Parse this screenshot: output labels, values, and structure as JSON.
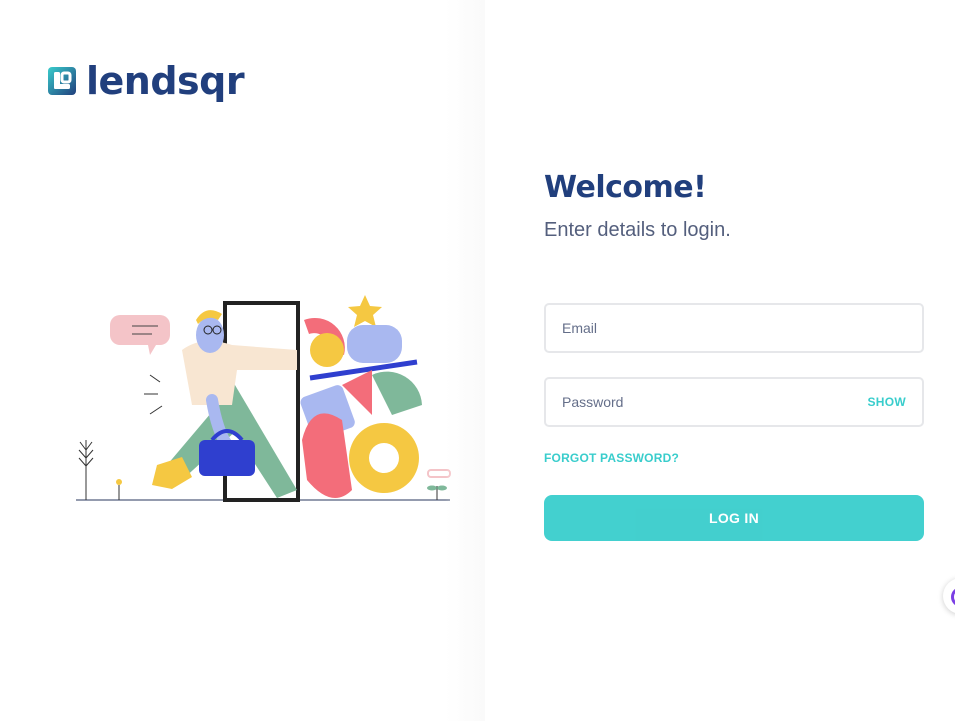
{
  "brand": {
    "name": "lendsqr",
    "primary_color": "#213f7d",
    "accent_color": "#39cdcc"
  },
  "login": {
    "title": "Welcome!",
    "subtitle": "Enter details to login.",
    "email_placeholder": "Email",
    "password_placeholder": "Password",
    "show_label": "SHOW",
    "forgot_label": "FORGOT PASSWORD?",
    "submit_label": "LOG IN"
  },
  "icons": {
    "logo": "lendsqr-logo-icon",
    "illustration": "sign-in-illustration",
    "chat": "chat-widget-icon"
  }
}
